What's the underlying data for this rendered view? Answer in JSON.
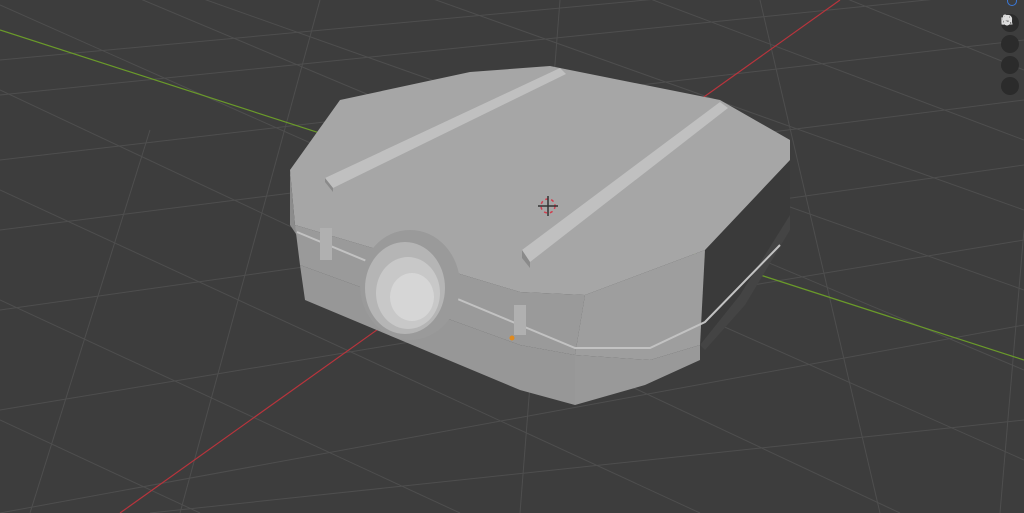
{
  "viewport": {
    "background": "#3d3d3d",
    "grid_color": "#4e4e4e",
    "x_axis_color": "#b8343c",
    "y_axis_color": "#6a9a2a",
    "object_color": "#a3a3a3",
    "origin_color": "#e08a1e"
  },
  "navigation_gizmo": {
    "z_axis_color": "#3a78d8",
    "buttons": [
      {
        "icon": "zoom-icon",
        "name": "zoom-button"
      },
      {
        "icon": "pan-hand-icon",
        "name": "pan-button"
      },
      {
        "icon": "camera-view-icon",
        "name": "camera-view-button"
      },
      {
        "icon": "perspective-grid-icon",
        "name": "perspective-toggle-button"
      }
    ]
  }
}
